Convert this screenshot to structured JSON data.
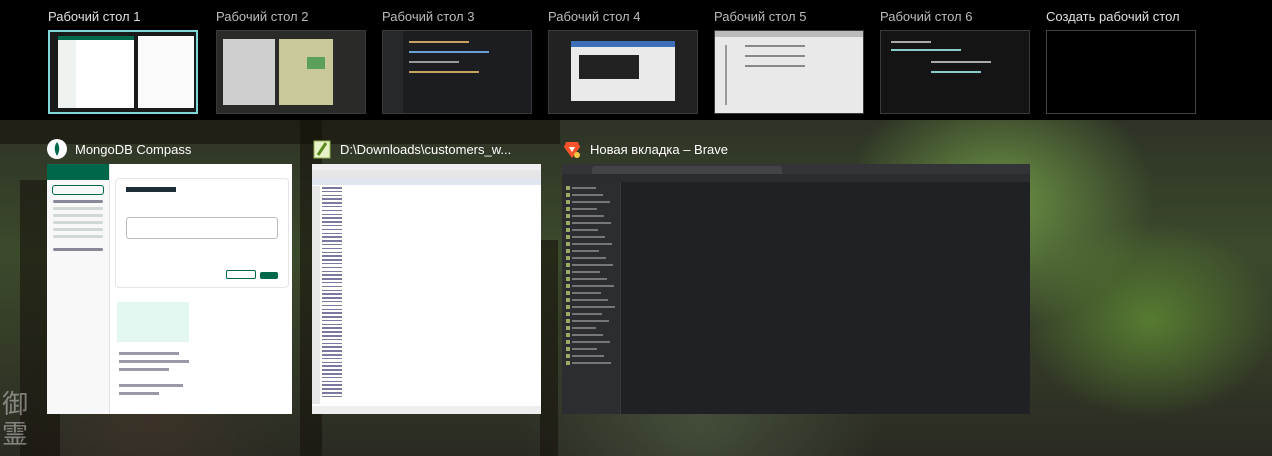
{
  "desktops": [
    {
      "label": "Рабочий стол 1",
      "active": true
    },
    {
      "label": "Рабочий стол 2",
      "active": false
    },
    {
      "label": "Рабочий стол 3",
      "active": false
    },
    {
      "label": "Рабочий стол 4",
      "active": false
    },
    {
      "label": "Рабочий стол 5",
      "active": false
    },
    {
      "label": "Рабочий стол 6",
      "active": false
    }
  ],
  "new_desktop_label": "Создать рабочий стол",
  "windows": {
    "compass": {
      "title": "MongoDB Compass",
      "icon": "mongodb-leaf-icon"
    },
    "notepad": {
      "title": "D:\\Downloads\\customers_w...",
      "icon": "notepad-plus-plus-icon"
    },
    "brave": {
      "title": "Новая вкладка – Brave",
      "icon": "brave-lion-icon"
    }
  },
  "colors": {
    "active_border": "#7fd8d8",
    "mongodb_green": "#00684a",
    "brave_orange": "#fb542b"
  }
}
